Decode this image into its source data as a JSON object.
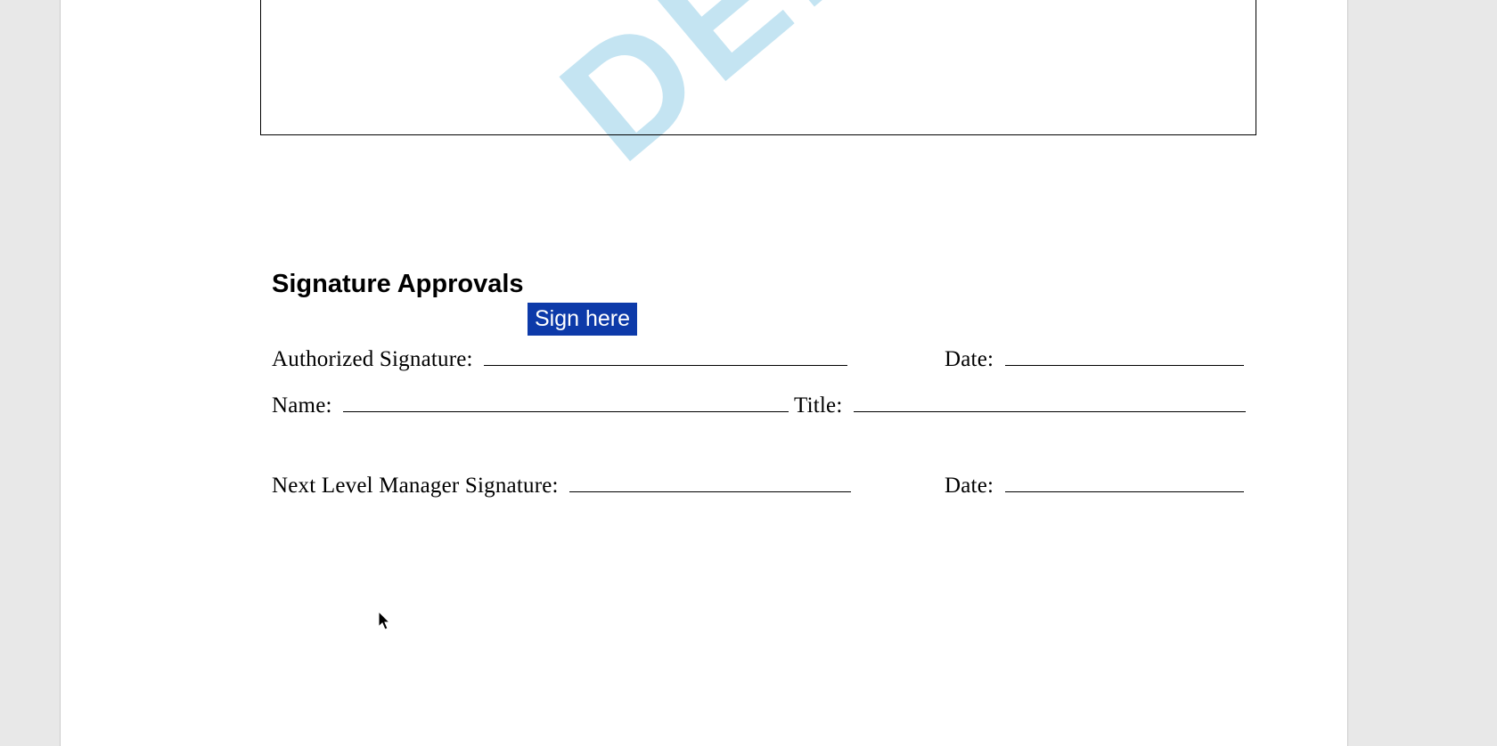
{
  "watermark_text": "DEM",
  "section": {
    "heading": "Signature Approvals"
  },
  "sign_tag": {
    "label": "Sign here"
  },
  "fields": {
    "authorized_signature_label": "Authorized Signature:",
    "authorized_date_label": "Date:",
    "name_label": "Name:",
    "title_label": "Title:",
    "next_manager_signature_label": "Next Level Manager Signature:",
    "next_manager_date_label": "Date:"
  },
  "colors": {
    "sign_tag_bg": "#0d3aa9",
    "watermark": "#c4e4f2"
  }
}
